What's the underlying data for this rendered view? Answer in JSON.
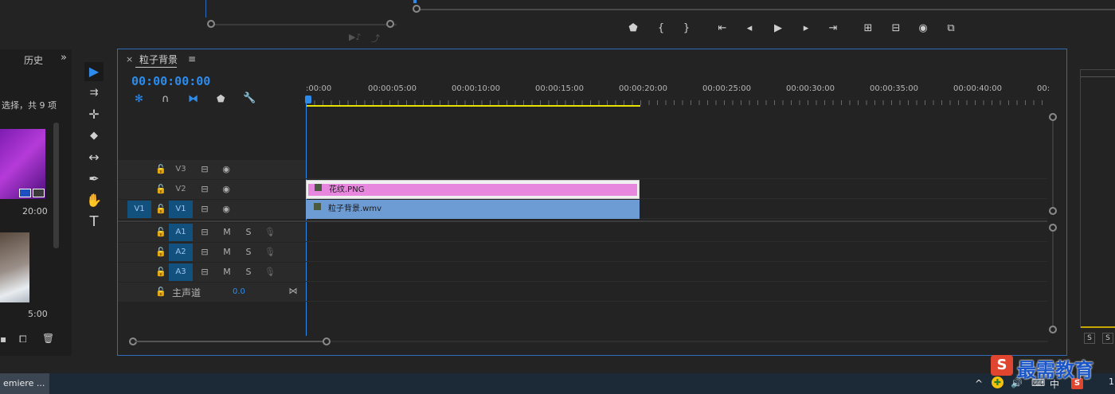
{
  "top": {
    "source_controls": [
      "▶♪",
      "⤴"
    ]
  },
  "program_transport": {
    "buttons": [
      "marker",
      "mark-in",
      "mark-out",
      "go-to-in",
      "step-back",
      "play",
      "step-forward",
      "go-to-out",
      "lift",
      "extract",
      "export-frame",
      "compare"
    ]
  },
  "project_panel": {
    "tab_label": "历史",
    "overflow_label": "»",
    "selection_text": "选择，共 9 项",
    "thumbs": [
      {
        "duration": "20:00"
      },
      {
        "duration": "5:00"
      }
    ]
  },
  "tools": [
    {
      "name": "selection-tool",
      "icon": "▶",
      "active": true
    },
    {
      "name": "track-select-tool",
      "icon": "⇉",
      "active": false
    },
    {
      "name": "ripple-edit-tool",
      "icon": "✛",
      "active": false
    },
    {
      "name": "razor-tool",
      "icon": "◆",
      "active": false
    },
    {
      "name": "slip-tool",
      "icon": "↔",
      "active": false
    },
    {
      "name": "pen-tool",
      "icon": "✒",
      "active": false
    },
    {
      "name": "hand-tool",
      "icon": "✋",
      "active": false
    },
    {
      "name": "type-tool",
      "icon": "T",
      "active": false
    }
  ],
  "timeline": {
    "close": "×",
    "sequence_name": "粒子背景",
    "menu": "≡",
    "timecode": "00:00:00:00",
    "ruler_labels": [
      ":00:00",
      "00:00:05:00",
      "00:00:10:00",
      "00:00:15:00",
      "00:00:20:00",
      "00:00:25:00",
      "00:00:30:00",
      "00:00:35:00",
      "00:00:40:00",
      "00:"
    ],
    "video_tracks": [
      {
        "source": "",
        "label": "V3",
        "clip": ""
      },
      {
        "source": "",
        "label": "V2",
        "clip": "花纹.PNG"
      },
      {
        "source": "V1",
        "label": "V1",
        "clip": "粒子背景.wmv"
      }
    ],
    "audio_tracks": [
      {
        "label": "A1",
        "m": "M",
        "s": "S"
      },
      {
        "label": "A2",
        "m": "M",
        "s": "S"
      },
      {
        "label": "A3",
        "m": "M",
        "s": "S"
      }
    ],
    "master": {
      "label": "主声道",
      "value": "0.0"
    }
  },
  "right_panel": {
    "s_buttons": [
      "S",
      "S"
    ]
  },
  "taskbar": {
    "app_label": "emiere ...",
    "tray": [
      "^",
      "✚",
      "🔊",
      "⌨",
      "中",
      "S"
    ],
    "clock": "1"
  },
  "watermark": {
    "logo": "S",
    "text": "最需教育"
  },
  "colors": {
    "accent": "#2d8ceb",
    "clip_pink": "#e787de",
    "clip_blue": "#6d9bd3",
    "work_area": "#e8e000"
  }
}
